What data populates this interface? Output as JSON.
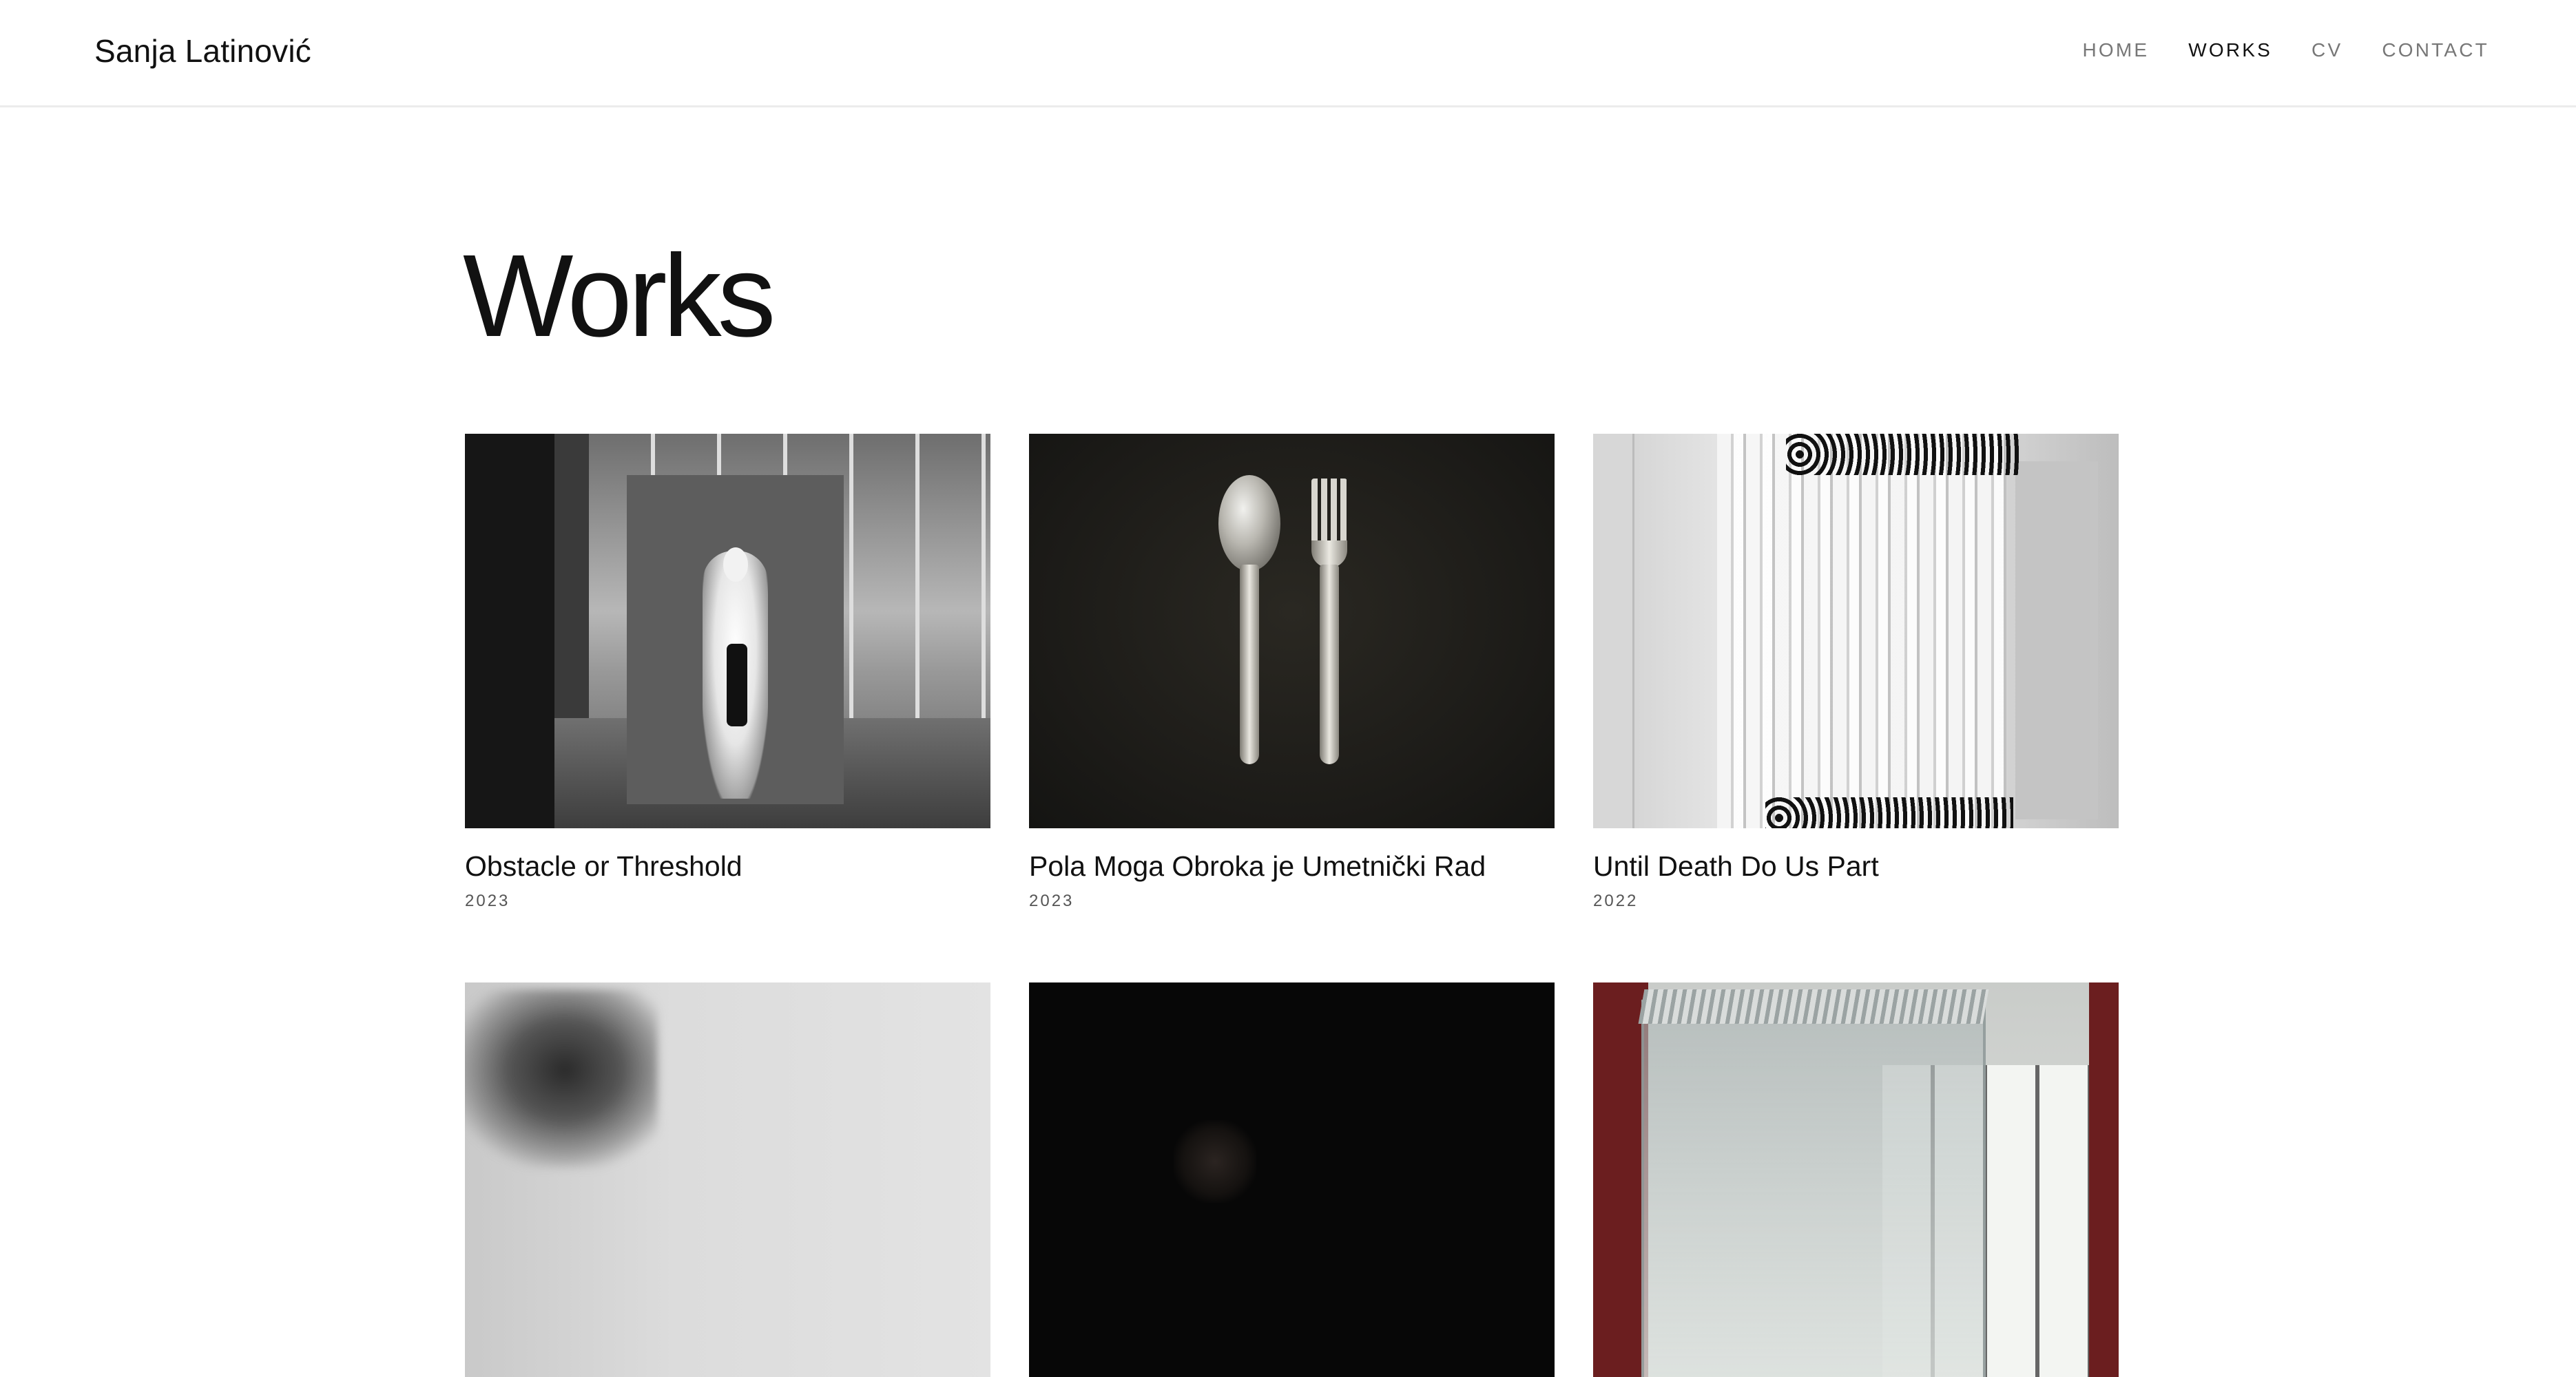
{
  "header": {
    "site_name": "Sanja Latinović",
    "nav": [
      {
        "label": "HOME",
        "active": false
      },
      {
        "label": "WORKS",
        "active": true
      },
      {
        "label": "CV",
        "active": false
      },
      {
        "label": "CONTACT",
        "active": false
      }
    ]
  },
  "main": {
    "title": "Works",
    "works": [
      {
        "title": "Obstacle or Threshold",
        "year": "2023"
      },
      {
        "title": "Pola Moga Obroka je Umetnički Rad",
        "year": "2023"
      },
      {
        "title": "Until Death Do Us Part",
        "year": "2022"
      },
      {
        "title": "",
        "year": ""
      },
      {
        "title": "",
        "year": ""
      },
      {
        "title": "",
        "year": ""
      }
    ]
  },
  "colors": {
    "text": "#111111",
    "nav_inactive": "#777777",
    "meta": "#555555",
    "background": "#ffffff",
    "divider": "#ececec"
  }
}
